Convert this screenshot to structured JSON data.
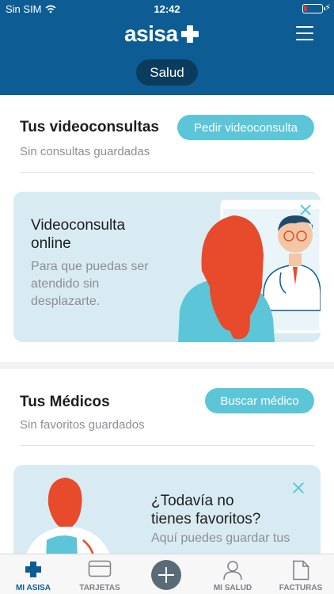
{
  "status_bar": {
    "carrier": "Sin SIM",
    "time": "12:42",
    "battery_color": "#e5322a"
  },
  "header": {
    "logo_text": "asisa",
    "segment_label": "Salud",
    "background": "#0d5d94"
  },
  "videoconsultas": {
    "title": "Tus videoconsultas",
    "subtitle": "Sin consultas guardadas",
    "button": "Pedir videoconsulta",
    "card_title": "Videoconsulta\nonline",
    "card_text": "Para que puedas ser\natendido sin\ndesplazarte."
  },
  "medicos": {
    "title": "Tus Médicos",
    "subtitle": "Sin favoritos guardados",
    "button": "Buscar médico",
    "card_title": "¿Todavía no\ntienes favoritos?",
    "card_text": "Aquí puedes guardar tus"
  },
  "tabs": [
    {
      "label": "MI ASISA",
      "icon": "asisa-cross-icon",
      "active": true
    },
    {
      "label": "TARJETAS",
      "icon": "card-icon",
      "active": false
    },
    {
      "label": "",
      "icon": "add-icon",
      "active": false
    },
    {
      "label": "MI SALUD",
      "icon": "person-icon",
      "active": false
    },
    {
      "label": "FACTURAS",
      "icon": "document-icon",
      "active": false
    }
  ],
  "colors": {
    "accent": "#5cc6d8",
    "brand": "#0d5d94",
    "card_bg": "#d8ebf3"
  }
}
